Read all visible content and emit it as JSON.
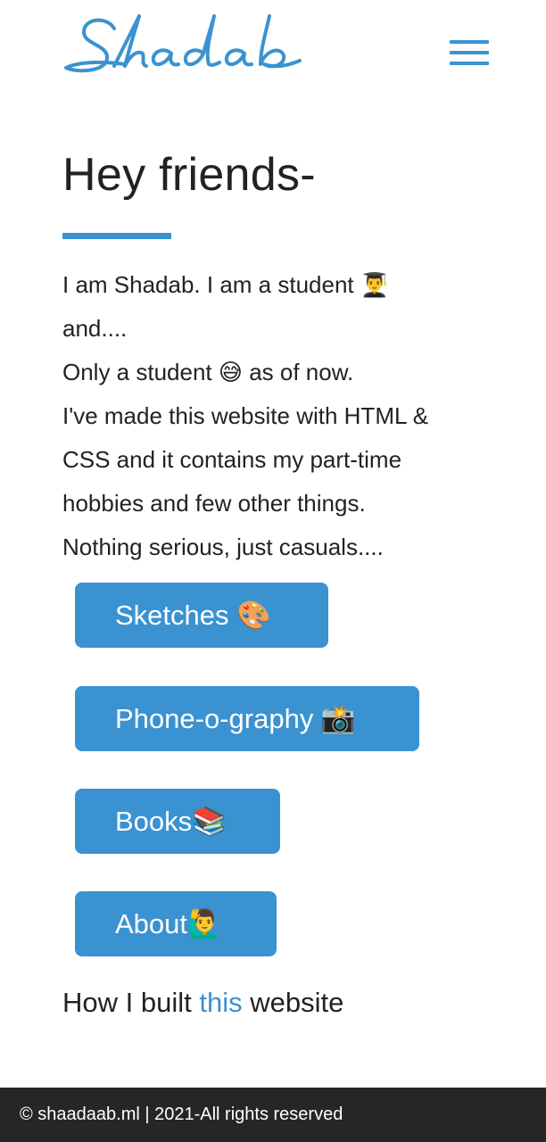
{
  "header": {
    "logo_text": "Shadab",
    "menu_icon": "hamburger-menu-icon"
  },
  "hero": {
    "title": "Hey friends-"
  },
  "intro": {
    "lines": [
      "I am Shadab. I am a student 👨‍🎓",
      "and....",
      "Only a student 😅 as of now.",
      "I've made this website with HTML &",
      "CSS and it contains my part-time",
      "hobbies and few other things.",
      "Nothing serious, just casuals...."
    ]
  },
  "nav_buttons": {
    "sketches": "Sketches 🎨",
    "phoneography": "Phone-o-graphy 📸",
    "books": "Books📚",
    "about": "About🙋‍♂️"
  },
  "built": {
    "prefix": "How I built ",
    "link": "this",
    "suffix": " website"
  },
  "footer": {
    "text": "© shaadaab.ml | 2021-All rights reserved"
  },
  "colors": {
    "accent": "#3a92d1",
    "text": "#222222",
    "footer_bg": "#262626",
    "background": "#ffffff"
  }
}
